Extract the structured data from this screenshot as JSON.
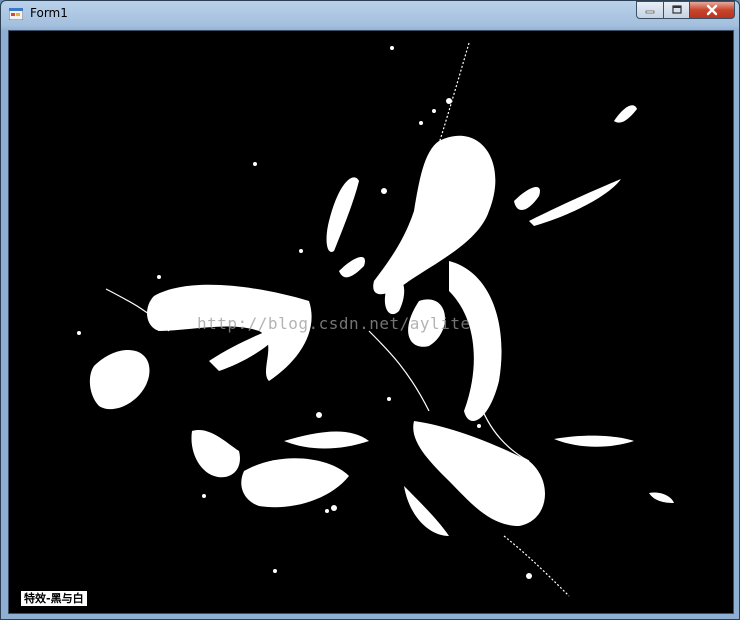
{
  "window": {
    "title": "Form1",
    "icon": "winforms-app-icon",
    "controls": [
      "minimize-icon",
      "maximize-icon",
      "close-icon"
    ]
  },
  "picture": {
    "description_colors": {
      "background": "#000000",
      "foreground": "#ffffff"
    },
    "watermark": "http://blog.csdn.net/aylite",
    "label": "特效-黑与白"
  }
}
